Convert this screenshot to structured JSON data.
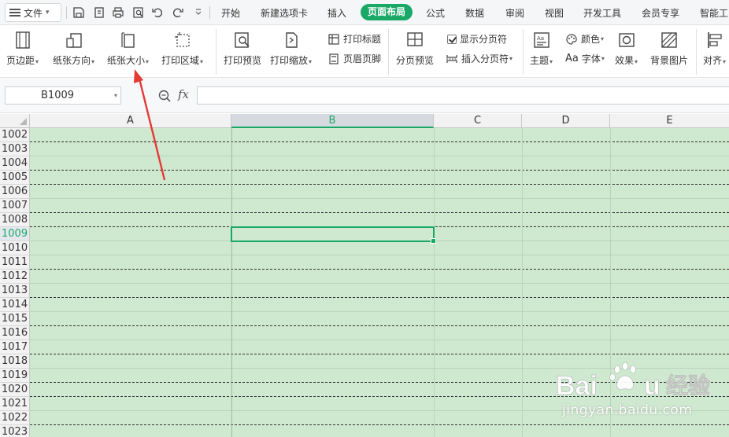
{
  "menubar": {
    "file_label": "文件",
    "tabs": [
      "开始",
      "新建选项卡",
      "插入",
      "页面布局",
      "公式",
      "数据",
      "审阅",
      "视图",
      "开发工具",
      "会员专享",
      "智能工"
    ],
    "active_tab": "页面布局"
  },
  "ribbon": {
    "margins": "页边距",
    "orientation": "纸张方向",
    "paper_size": "纸张大小",
    "print_area": "打印区域",
    "print_preview": "打印预览",
    "print_scale": "打印缩放",
    "print_titles": "打印标题",
    "header_footer": "页眉页脚",
    "page_break_preview": "分页预览",
    "show_page_breaks": "显示分页符",
    "insert_page_break": "插入分页符",
    "theme": "主题",
    "colors": "颜色",
    "fonts": "字体",
    "effects": "效果",
    "background_image": "背景图片",
    "align": "对齐"
  },
  "formula_bar": {
    "name_box": "B1009",
    "fx_label": "fx",
    "formula": ""
  },
  "grid": {
    "columns": [
      "A",
      "B",
      "C",
      "D",
      "E"
    ],
    "selected_column": "B",
    "rows": [
      "1002",
      "1003",
      "1004",
      "1005",
      "1006",
      "1007",
      "1008",
      "1009",
      "1010",
      "1011",
      "1012",
      "1013",
      "1014",
      "1015",
      "1016",
      "1017",
      "1018",
      "1019",
      "1020",
      "1021",
      "1022",
      "1023"
    ],
    "selected_row": "1009",
    "page_break_after_rows": [
      "1002",
      "1004",
      "1005",
      "1007",
      "1008",
      "1011",
      "1013",
      "1015",
      "1017",
      "1019",
      "1020",
      "1022"
    ],
    "cell_fill_color": "#cfe8d0"
  },
  "annotation": {
    "arrow_color": "#e53935",
    "points_to": "纸张大小"
  },
  "watermark": {
    "brand": "Baidu经验",
    "url": "jingyan.baidu.com"
  },
  "colors": {
    "accent": "#1aa867"
  }
}
